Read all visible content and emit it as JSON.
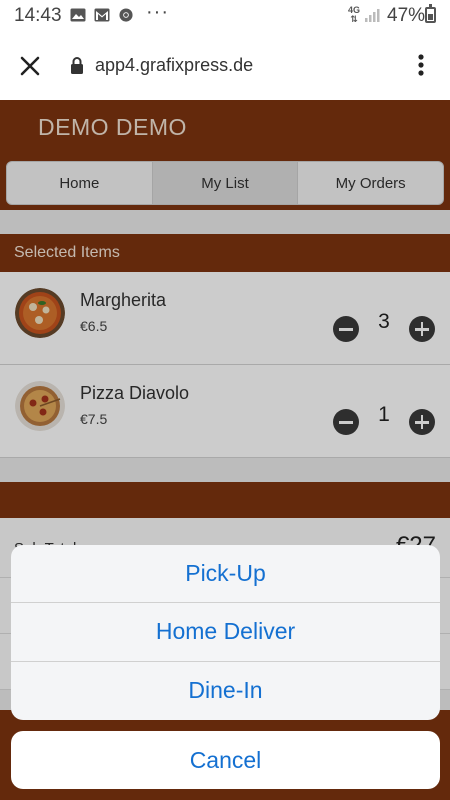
{
  "status_bar": {
    "time": "14:43",
    "network": "4G",
    "battery": "47%",
    "notification_icons": [
      "gallery-icon",
      "gmail-icon",
      "chrome-icon"
    ],
    "more": "···"
  },
  "browser": {
    "url": "app4.grafixpress.de"
  },
  "app": {
    "title": "DEMO DEMO",
    "tabs": [
      {
        "label": "Home",
        "active": false
      },
      {
        "label": "My List",
        "active": true
      },
      {
        "label": "My Orders",
        "active": false
      }
    ],
    "section_title": "Selected Items",
    "items": [
      {
        "name": "Margherita",
        "price": "€6.5",
        "quantity": "3"
      },
      {
        "name": "Pizza Diavolo",
        "price": "€7.5",
        "quantity": "1"
      }
    ],
    "subtotal": {
      "label": "Sub Total",
      "value": "€27"
    }
  },
  "action_sheet": {
    "options": [
      "Pick-Up",
      "Home Deliver",
      "Dine-In"
    ],
    "cancel": "Cancel"
  },
  "colors": {
    "brand": "#7d3410",
    "action_text": "#1470d1"
  }
}
